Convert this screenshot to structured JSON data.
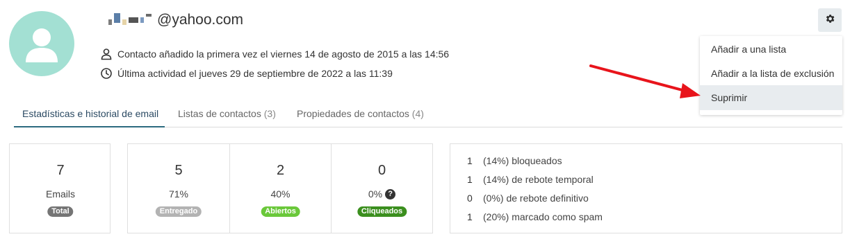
{
  "contact": {
    "email_visible": "@yahoo.com",
    "added_text": "Contacto añadido la primera vez el viernes 14 de agosto de 2015 a las 14:56",
    "last_activity_text": "Última actividad el jueves 29 de septiembre de 2022 a las 11:39"
  },
  "icons": {
    "avatar": "user-silhouette-icon",
    "added": "person-outline-icon",
    "activity": "clock-icon",
    "settings": "gear-icon",
    "help": "question-circle-icon"
  },
  "tabs": [
    {
      "label": "Estadísticas e historial de email",
      "count": ""
    },
    {
      "label": "Listas de contactos",
      "count": "(3)"
    },
    {
      "label": "Propiedades de contactos",
      "count": "(4)"
    }
  ],
  "menu": {
    "items": [
      {
        "label": "Añadir a una lista"
      },
      {
        "label": "Añadir a la lista de exclusión"
      },
      {
        "label": "Suprimir"
      }
    ],
    "highlighted_index": 2
  },
  "stats": [
    {
      "value": "7",
      "label": "Emails",
      "badge": "Total",
      "badge_color": "#757575"
    },
    {
      "value": "5",
      "label": "71%",
      "badge": "Entregado",
      "badge_color": "#b3b3b3"
    },
    {
      "value": "2",
      "label": "40%",
      "badge": "Abiertos",
      "badge_color": "#6ac83a"
    },
    {
      "value": "0",
      "label": "0%",
      "badge": "Cliqueados",
      "badge_color": "#3b8f1e"
    }
  ],
  "summary": [
    {
      "count": "1",
      "text": "(14%) bloqueados"
    },
    {
      "count": "1",
      "text": "(14%) de rebote temporal"
    },
    {
      "count": "0",
      "text": "(0%) de rebote definitivo"
    },
    {
      "count": "1",
      "text": "(20%) marcado como spam"
    }
  ],
  "colors": {
    "avatar_bg": "#a3e0d3",
    "active_tab": "#2b6a7f",
    "arrow": "#e8141b"
  }
}
